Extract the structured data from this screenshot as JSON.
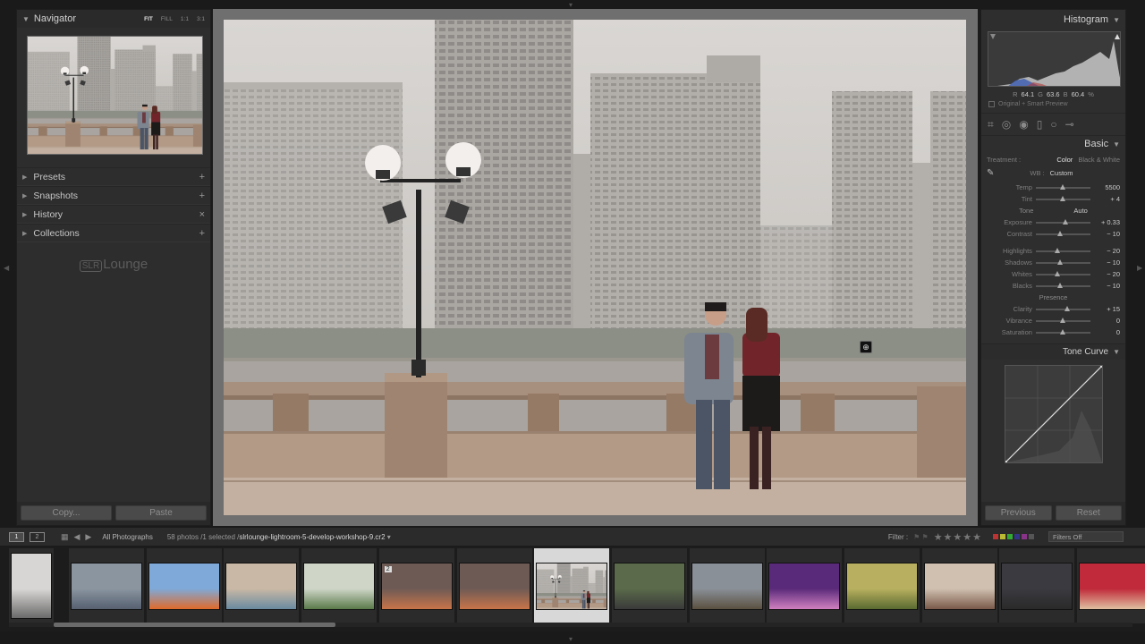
{
  "navigator": {
    "title": "Navigator",
    "zoom_options": [
      "FIT",
      "FILL",
      "1:1",
      "3:1"
    ]
  },
  "left_sections": [
    {
      "label": "Presets",
      "action": "+"
    },
    {
      "label": "Snapshots",
      "action": "+"
    },
    {
      "label": "History",
      "action": "×"
    },
    {
      "label": "Collections",
      "action": "+"
    }
  ],
  "logo": {
    "box": "SLR",
    "text": "Lounge"
  },
  "left_buttons": {
    "copy": "Copy...",
    "paste": "Paste"
  },
  "histogram": {
    "title": "Histogram",
    "r_label": "R",
    "r_value": "64.1",
    "g_label": "G",
    "g_value": "63.6",
    "b_label": "B",
    "b_value": "60.4",
    "pct": "%",
    "preview": "Original + Smart Preview"
  },
  "basic": {
    "title": "Basic",
    "treatment_label": "Treatment :",
    "treatment_color": "Color",
    "treatment_bw": "Black & White",
    "wb_label": "WB :",
    "wb_value": "Custom",
    "tone_label": "Tone",
    "auto_label": "Auto",
    "presence_label": "Presence",
    "sliders_wb": [
      {
        "label": "Temp",
        "value": "5500",
        "pos": 0.5
      },
      {
        "label": "Tint",
        "value": "+ 4",
        "pos": 0.5
      }
    ],
    "sliders_tone": [
      {
        "label": "Exposure",
        "value": "+ 0.33",
        "pos": 0.55
      },
      {
        "label": "Contrast",
        "value": "− 10",
        "pos": 0.45
      }
    ],
    "sliders_tone2": [
      {
        "label": "Highlights",
        "value": "− 20",
        "pos": 0.4
      },
      {
        "label": "Shadows",
        "value": "− 10",
        "pos": 0.45
      },
      {
        "label": "Whites",
        "value": "− 20",
        "pos": 0.4
      },
      {
        "label": "Blacks",
        "value": "− 10",
        "pos": 0.45
      }
    ],
    "sliders_presence": [
      {
        "label": "Clarity",
        "value": "+ 15",
        "pos": 0.57
      },
      {
        "label": "Vibrance",
        "value": "0",
        "pos": 0.5
      },
      {
        "label": "Saturation",
        "value": "0",
        "pos": 0.5
      }
    ]
  },
  "tone_curve": {
    "title": "Tone Curve"
  },
  "right_buttons": {
    "previous": "Previous",
    "reset": "Reset"
  },
  "filmstrip_bar": {
    "page1": "1",
    "page2": "2",
    "source": "All Photographs",
    "count_prefix": "58 photos /1 selected /",
    "filename": "slrlounge-lightroom-5-develop-workshop-9.cr2",
    "filter_label": "Filter :",
    "filters_off": "Filters Off"
  },
  "filmstrip": {
    "thumbs": [
      {
        "badge": ""
      },
      {
        "badge": ""
      },
      {
        "badge": ""
      },
      {
        "badge": ""
      },
      {
        "badge": ""
      },
      {
        "badge": "2"
      },
      {
        "badge": ""
      },
      {
        "badge": ""
      },
      {
        "badge": ""
      },
      {
        "badge": ""
      },
      {
        "badge": ""
      },
      {
        "badge": ""
      },
      {
        "badge": ""
      },
      {
        "badge": ""
      },
      {
        "badge": ""
      }
    ],
    "selected_index": 7
  },
  "colors": {
    "panel_bg": "#2d2d2d",
    "canvas_bg": "#6f6f6f",
    "text": "#b8b8b8"
  }
}
